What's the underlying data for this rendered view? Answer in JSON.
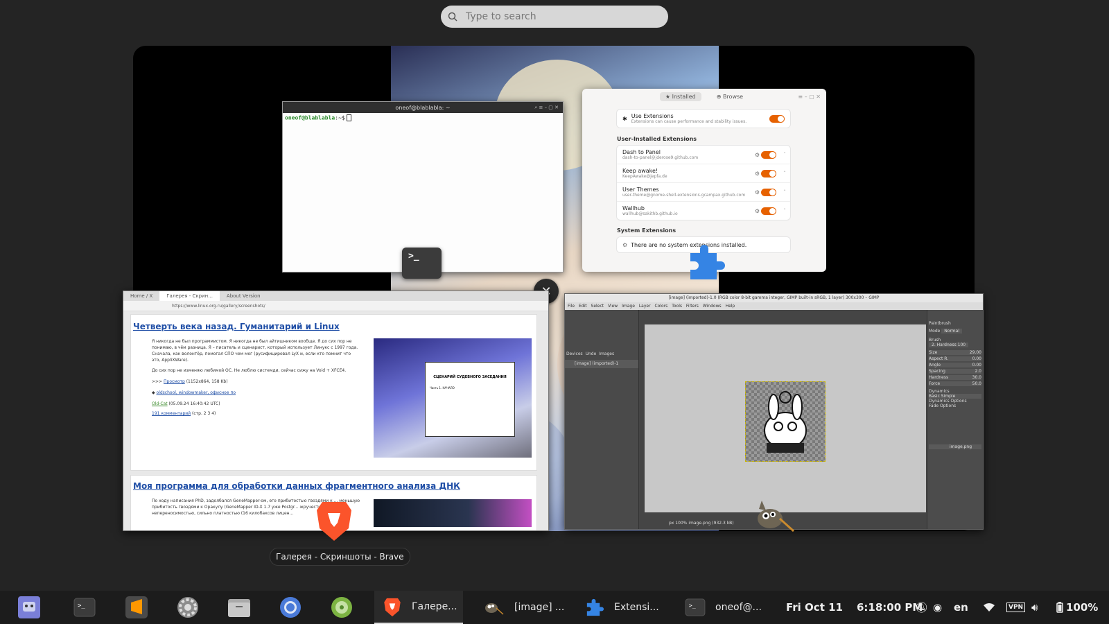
{
  "search": {
    "placeholder": "Type to search"
  },
  "terminal": {
    "title": "oneof@blablabla: ~",
    "prompt": "oneof@blablabla",
    "prompt_suffix": ":~$"
  },
  "extensions": {
    "tabs": [
      "Installed",
      "Browse"
    ],
    "use_extensions": {
      "name": "Use Extensions",
      "desc": "Extensions can cause performance and stability issues."
    },
    "user_header": "User-Installed Extensions",
    "items": [
      {
        "name": "Dash to Panel",
        "id": "dash-to-panel@jderose9.github.com"
      },
      {
        "name": "Keep awake!",
        "id": "KeepAwake@jepfa.de"
      },
      {
        "name": "User Themes",
        "id": "user-theme@gnome-shell-extensions.gcampax.github.com"
      },
      {
        "name": "Wallhub",
        "id": "wallhub@sakithb.github.io"
      }
    ],
    "system_header": "System Extensions",
    "system_empty": "There are no system extensions installed."
  },
  "browser": {
    "tabs": [
      "Home / X",
      "Галерея - Скрин...",
      "About Version"
    ],
    "url": "https://www.linux.org.ru/gallery/screenshots/",
    "article1": {
      "title": "Четверть века назад. Гуманитарий и Linux",
      "p1": "Я никогда не был программистом. Я никогда не был айтишником вообще. Я до сих пор не понимаю, в чём разница. Я – писатель и сценарист, который использует Линукс с 1997 года. Сначала, как волонтёр, помогал СПО чем мог (русифицировал LyX и, если кто помнит что это, AppliXWare).",
      "p2": "До сих пор не изменяю любимой ОС. Не люблю системди, сейчас сижу на Void + XFCE4.",
      "view_prefix": ">>> ",
      "view_link": "Просмотр",
      "view_meta": " (1152x864, 158 Kb)",
      "tags": "oldschool, windowmaker, офисное по",
      "author": "Old-Cat",
      "date": " (05.09.24 16:40:42 UTC)",
      "comments": "191 комментарий",
      "pages": " (стр. 2 3 4)",
      "thumb_heading": "СЦЕНАРИЙ СУДЕБНОГО ЗАСЕДАНИЯ",
      "thumb_chapter": "Часть 1. НАЧАЛО"
    },
    "article2": {
      "title": "Моя программа для обработки данных фрагментного анализа ДНК",
      "p1": "По ходу написания PhD, задолбался GeneMapper-ом, его прибитостью гвоздями к ... меньшую прибитость гвоздями к Оракулу (GeneMapper ID-X 1.7 уже Postgr... жручестью, непереносимостью, сильно платностью (16 килобаксов лицен..."
    }
  },
  "tooltip": "Галерея - Скриншоты - Brave",
  "gimp": {
    "title": "[image] (imported)-1.0 (RGB color 8-bit gamma integer, GIMP built-in sRGB, 1 layer) 300x300 – GIMP",
    "menu": [
      "File",
      "Edit",
      "Select",
      "View",
      "Image",
      "Layer",
      "Colors",
      "Tools",
      "Filters",
      "Windows",
      "Help"
    ],
    "left_tabs": [
      "Devices",
      "Undo",
      "Images"
    ],
    "image_item": "[image] (imported)-1",
    "tool_name": "Paintbrush",
    "mode_label": "Mode",
    "mode_value": "Normal",
    "brush_label": "Brush",
    "brush_value": "2. Hardness 100",
    "opts": [
      {
        "label": "Size",
        "value": "29.00"
      },
      {
        "label": "Aspect R.",
        "value": "0.00"
      },
      {
        "label": "Angle",
        "value": "0.00"
      },
      {
        "label": "Spacing",
        "value": "2.0"
      },
      {
        "label": "Hardness",
        "value": "30.0"
      },
      {
        "label": "Force",
        "value": "50.0"
      }
    ],
    "dynamics_label": "Dynamics",
    "dynamics_value": "Basic Simple",
    "dyn_options": "Dynamics Options",
    "fade_options": "Fade Options",
    "layer_name": "image.png",
    "zoom": "100%",
    "unit": "px",
    "status": "image.png (932.3 kB)"
  },
  "taskbar": {
    "windows": [
      {
        "label": "Галере...",
        "icon": "brave-icon"
      },
      {
        "label": "[image] ...",
        "icon": "gimp-icon"
      },
      {
        "label": "Extensi...",
        "icon": "puzzle-icon"
      },
      {
        "label": "oneof@...",
        "icon": "terminal-icon"
      }
    ],
    "date": "Fri Oct 11",
    "time": "6:18:00 PM",
    "lang": "en",
    "battery": "100%"
  },
  "colors": {
    "accent_orange": "#e66100",
    "link_blue": "#1f4ea6",
    "brave_orange": "#fb542b"
  }
}
